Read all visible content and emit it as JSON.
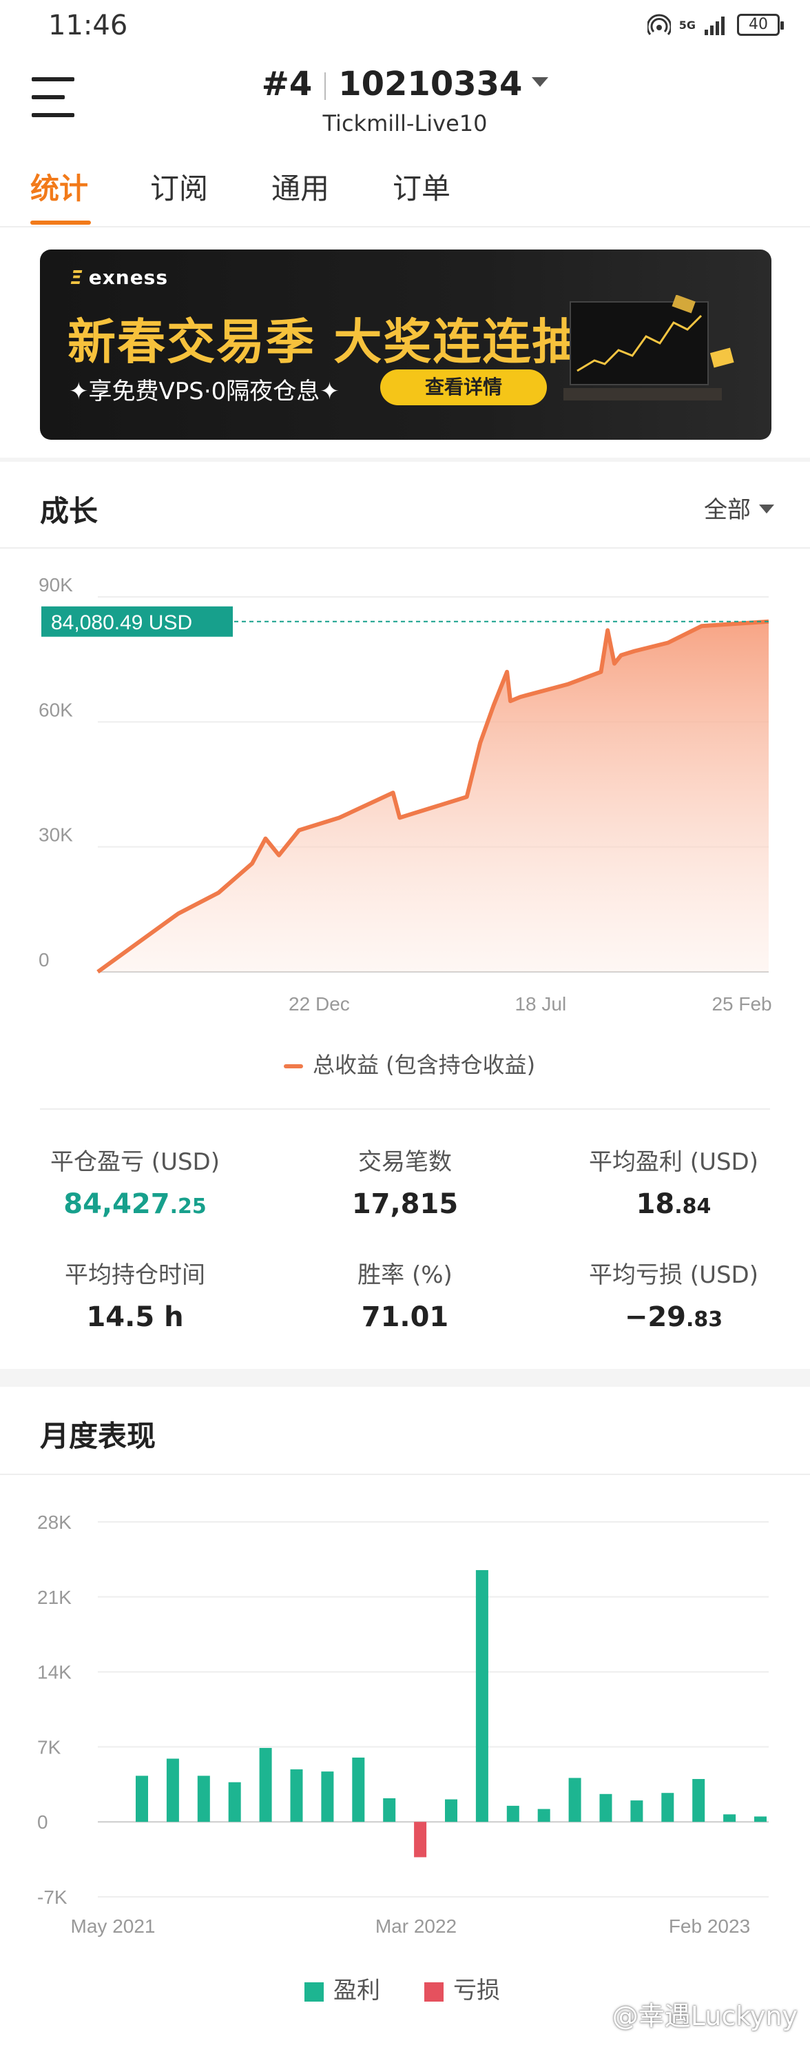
{
  "status_bar": {
    "time": "11:46",
    "network": "5G",
    "battery": "40"
  },
  "header": {
    "account_num": "#4",
    "account_id": "10210334",
    "server": "Tickmill-Live10"
  },
  "tabs": [
    {
      "label": "统计",
      "active": true
    },
    {
      "label": "订阅",
      "active": false
    },
    {
      "label": "通用",
      "active": false
    },
    {
      "label": "订单",
      "active": false
    }
  ],
  "banner": {
    "brand": "exness",
    "headline": "新春交易季 大奖连连抽",
    "subtitle": "✦享免费VPS·0隔夜仓息✦",
    "cta": "查看详情"
  },
  "growth": {
    "title": "成长",
    "range": "全部",
    "legend": "总收益 (包含持仓收益)"
  },
  "stats": {
    "closed_pl_label": "平仓盈亏 (USD)",
    "closed_pl_int": "84,427",
    "closed_pl_dec": ".25",
    "trades_label": "交易笔数",
    "trades_value": "17,815",
    "avg_profit_label": "平均盈利 (USD)",
    "avg_profit_int": "18",
    "avg_profit_dec": ".84",
    "avg_hold_label": "平均持仓时间",
    "avg_hold_value": "14.5 h",
    "winrate_label": "胜率 (%)",
    "winrate_value": "71.01",
    "avg_loss_label": "平均亏损 (USD)",
    "avg_loss_int": "−29",
    "avg_loss_dec": ".83"
  },
  "monthly": {
    "title": "月度表现",
    "legend_profit": "盈利",
    "legend_loss": "亏损"
  },
  "watermark": "@幸遇Luckyny",
  "colors": {
    "accent": "#f27a1a",
    "growth_line": "#f07a4a",
    "teal": "#17a08c",
    "profit": "#1db591",
    "loss": "#e5515e"
  },
  "chart_data": [
    {
      "type": "area",
      "ylim": [
        0,
        90000
      ],
      "yticks": [
        "0",
        "30K",
        "60K",
        "90K"
      ],
      "xtick_labels": [
        "22 Dec",
        "18 Jul",
        "25 Feb"
      ],
      "current_value_label": "84,080.49 USD",
      "current_value": 84080.49,
      "series": [
        {
          "name": "总收益 (包含持仓收益)",
          "t": [
            0,
            0.06,
            0.12,
            0.18,
            0.23,
            0.25,
            0.27,
            0.3,
            0.36,
            0.44,
            0.45,
            0.47,
            0.55,
            0.57,
            0.59,
            0.61,
            0.615,
            0.63,
            0.7,
            0.75,
            0.76,
            0.77,
            0.78,
            0.8,
            0.85,
            0.9,
            1.0
          ],
          "values": [
            0,
            7000,
            14000,
            19000,
            26000,
            32000,
            28000,
            34000,
            37000,
            43000,
            37000,
            38000,
            42000,
            55000,
            64000,
            72000,
            65000,
            66000,
            69000,
            72000,
            82000,
            74000,
            76000,
            77000,
            79000,
            83000,
            84080
          ]
        }
      ]
    },
    {
      "type": "bar",
      "ylim": [
        -7000,
        28000
      ],
      "yticks": [
        "-7K",
        "0",
        "7K",
        "14K",
        "21K",
        "28K"
      ],
      "xtick_labels": [
        "May 2021",
        "Mar 2022",
        "Feb 2023"
      ],
      "values": [
        4300,
        5900,
        4300,
        3700,
        6900,
        4900,
        4700,
        6000,
        2200,
        -3300,
        2100,
        23500,
        1500,
        1200,
        4100,
        2600,
        2000,
        2700,
        4000,
        700,
        500
      ]
    }
  ]
}
